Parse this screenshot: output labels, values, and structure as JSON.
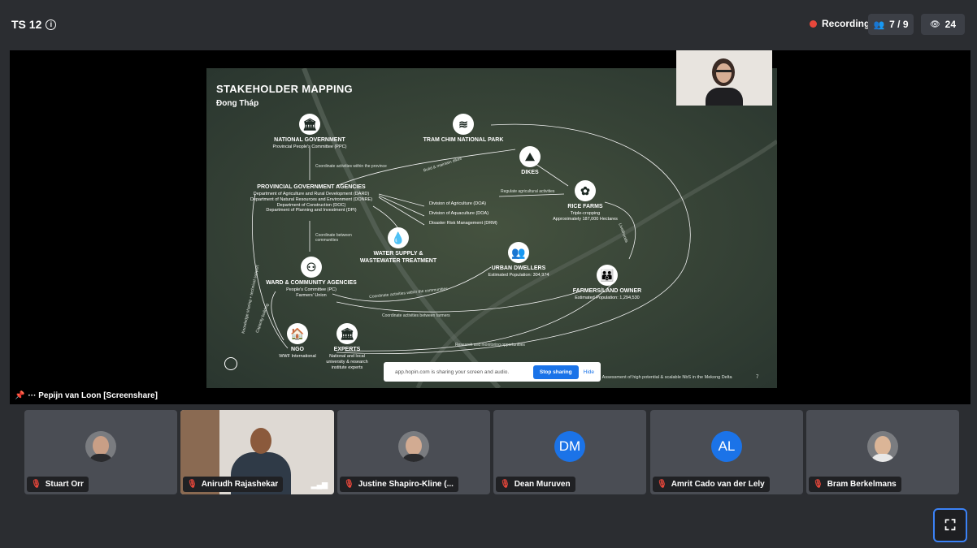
{
  "header": {
    "room_title": "TS 12",
    "recording_label": "Recording",
    "attendees_count": "7 / 9",
    "viewers_count": "24"
  },
  "colors": {
    "accent": "#1b73e8",
    "record": "#e8473b",
    "background": "#2b2d31",
    "tile": "#4a4d54"
  },
  "slide": {
    "title": "STAKEHOLDER MAPPING",
    "subtitle": "Đong Tháp",
    "nodes": {
      "national_gov": {
        "title": "NATIONAL GOVERNMENT",
        "sub": "Provincial People's Committee (PPC)"
      },
      "tram_chim": {
        "title": "TRAM CHIM NATIONAL PARK"
      },
      "dikes": {
        "title": "DIKES"
      },
      "provincial": {
        "title": "PROVINCIAL GOVERNMENT AGENCIES",
        "lines": [
          "Department of Agriculture and Rural Development (DARD)",
          "Department of Natural Resources and Environment (DONRE)",
          "Department of Construction (DOC)",
          "Department of Planning and Investment (DPI)"
        ]
      },
      "divisions": [
        "Division of Agriculture (DOA)",
        "Division of Aquaculture (DOA)",
        "Disaster Risk Management (DRM)"
      ],
      "rice_farms": {
        "title": "RICE FARMS",
        "sub": "Triple-cropping",
        "sub2": "Approximately 187,000 Hectares"
      },
      "water": {
        "title": "WATER SUPPLY &",
        "title2": "WASTEWATER TREATMENT"
      },
      "urban": {
        "title": "URBAN DWELLERS",
        "sub": "Estimated Population: 304,974"
      },
      "farmers": {
        "title": "FARMERS/LAND OWNER",
        "sub": "Estimated Population: 1,294,530"
      },
      "ward": {
        "title": "WARD & COMMUNITY AGENCIES",
        "sub": "People's Committee (PC)",
        "sub2": "Farmers' Union"
      },
      "ngo": {
        "title": "NGO",
        "sub": "WWF International"
      },
      "experts": {
        "title": "EXPERTS",
        "sub": "National and local",
        "sub2": "university & research",
        "sub3": "institute experts"
      }
    },
    "flow_labels": {
      "coordinate_province": "Coordinate activities within the province",
      "build_maintain": "Build & maintain dikes",
      "regulate": "Regulate agricultural activities",
      "coordinate_communities": "Coordinate between communities",
      "coordinate_communes": "Coordinate activities within the communities",
      "coordinate_farmers": "Coordinate activities between farmers",
      "research": "Research and monitoring opportunities",
      "knowledge": "Knowledge sharing + technical support",
      "capacity": "Capacity building",
      "livelihoods": "Livelihoods"
    },
    "footer": "| Assessment of high potential & scalable NbS in the Mekong Delta",
    "page_number": "7"
  },
  "share_bar": {
    "text": "app.hopin.com is sharing your screen and audio.",
    "stop_label": "Stop sharing",
    "hide_label": "Hide"
  },
  "screenshare_label": "··· Pepijn van Loon [Screenshare]",
  "participants": [
    {
      "name": "Stuart Orr",
      "type": "photo"
    },
    {
      "name": "Anirudh Rajashekar",
      "type": "video"
    },
    {
      "name": "Justine Shapiro-Kline (...",
      "type": "photo"
    },
    {
      "name": "Dean Muruven",
      "type": "initials",
      "initials": "DM"
    },
    {
      "name": "Amrit Cado van der Lely",
      "type": "initials",
      "initials": "AL"
    },
    {
      "name": "Bram Berkelmans",
      "type": "photo"
    }
  ]
}
